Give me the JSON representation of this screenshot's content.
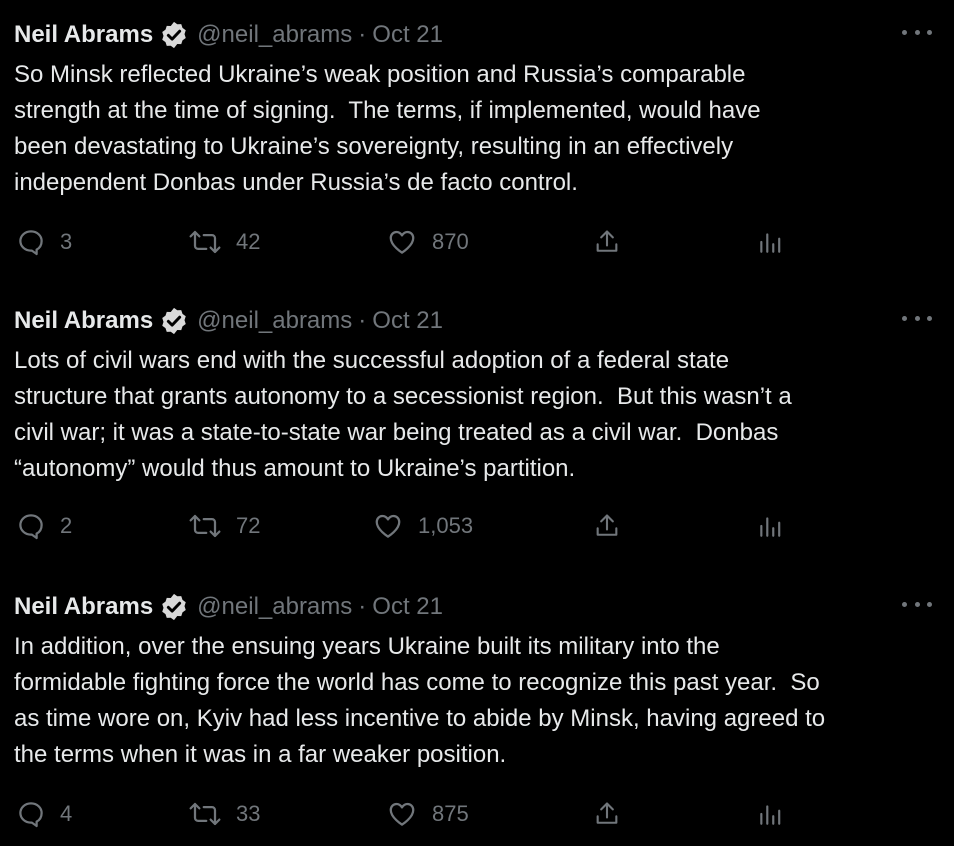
{
  "colors": {
    "background": "#000000",
    "text_primary": "#e7e9ea",
    "text_secondary": "#71767b",
    "verified_badge": "#d9d9d9"
  },
  "tweets": [
    {
      "author_name": "Neil Abrams",
      "verified_icon": "verified-badge-icon",
      "handle": "@neil_abrams",
      "separator": "·",
      "date": "Oct 21",
      "text": "So Minsk reflected Ukraine’s weak position and Russia’s comparable\nstrength at the time of signing.  The terms, if implemented, would have\nbeen devastating to Ukraine’s sovereignty, resulting in an effectively\nindependent Donbas under Russia’s de facto control.",
      "replies": "3",
      "retweets": "42",
      "likes": "870"
    },
    {
      "author_name": "Neil Abrams",
      "verified_icon": "verified-badge-icon",
      "handle": "@neil_abrams",
      "separator": "·",
      "date": "Oct 21",
      "text": "Lots of civil wars end with the successful adoption of a federal state\nstructure that grants autonomy to a secessionist region.  But this wasn’t a\ncivil war; it was a state-to-state war being treated as a civil war.  Donbas\n“autonomy” would thus amount to Ukraine’s partition.",
      "replies": "2",
      "retweets": "72",
      "likes": "1,053"
    },
    {
      "author_name": "Neil Abrams",
      "verified_icon": "verified-badge-icon",
      "handle": "@neil_abrams",
      "separator": "·",
      "date": "Oct 21",
      "text": "In addition, over the ensuing years Ukraine built its military into the\nformidable fighting force the world has come to recognize this past year.  So\nas time wore on, Kyiv had less incentive to abide by Minsk, having agreed to\nthe terms when it was in a far weaker position.",
      "replies": "4",
      "retweets": "33",
      "likes": "875"
    }
  ]
}
